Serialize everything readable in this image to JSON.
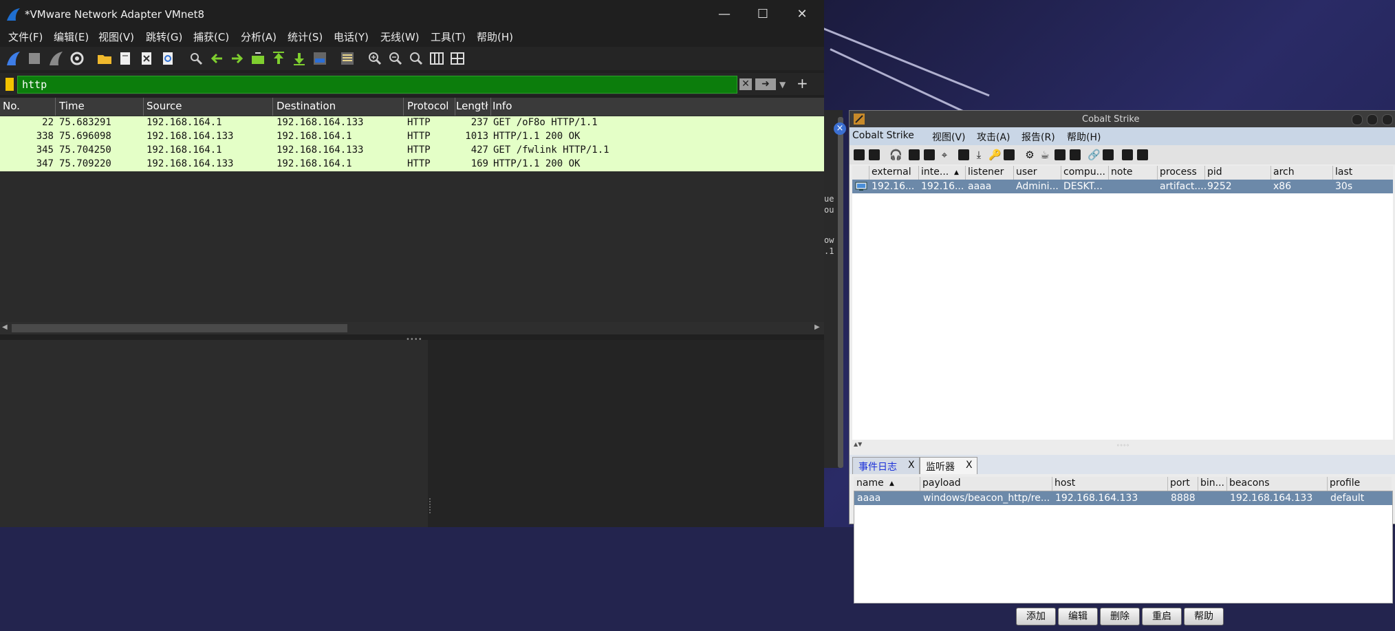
{
  "wireshark": {
    "title": "*VMware Network Adapter VMnet8",
    "menu": [
      "文件(F)",
      "编辑(E)",
      "视图(V)",
      "跳转(G)",
      "捕获(C)",
      "分析(A)",
      "统计(S)",
      "电话(Y)",
      "无线(W)",
      "工具(T)",
      "帮助(H)"
    ],
    "filter": "http",
    "columns": [
      "No.",
      "Time",
      "Source",
      "Destination",
      "Protocol",
      "Lengtł",
      "Info"
    ],
    "packets": [
      {
        "no": "22",
        "time": "75.683291",
        "src": "192.168.164.1",
        "dst": "192.168.164.133",
        "proto": "HTTP",
        "len": "237",
        "info": "GET /oF8o HTTP/1.1"
      },
      {
        "no": "338",
        "time": "75.696098",
        "src": "192.168.164.133",
        "dst": "192.168.164.1",
        "proto": "HTTP",
        "len": "1013",
        "info": "HTTP/1.1 200 OK"
      },
      {
        "no": "345",
        "time": "75.704250",
        "src": "192.168.164.1",
        "dst": "192.168.164.133",
        "proto": "HTTP",
        "len": "427",
        "info": "GET /fwlink HTTP/1.1"
      },
      {
        "no": "347",
        "time": "75.709220",
        "src": "192.168.164.133",
        "dst": "192.168.164.1",
        "proto": "HTTP",
        "len": "169",
        "info": "HTTP/1.1 200 OK"
      }
    ]
  },
  "terminal": {
    "fragments": [
      "ue",
      "ou",
      "ow",
      ".1"
    ]
  },
  "cobalt": {
    "title": "Cobalt Strike",
    "menu": [
      "Cobalt Strike",
      "视图(V)",
      "攻击(A)",
      "报告(R)",
      "帮助(H)"
    ],
    "session_columns": [
      "external",
      "inte...",
      "listener",
      "user",
      "compu...",
      "note",
      "process",
      "pid",
      "arch",
      "last"
    ],
    "session": {
      "external": "192.16...",
      "internal": "192.16...",
      "listener": "aaaa",
      "user": "Admini...",
      "computer": "DESKT...",
      "note": "",
      "process": "artifact....",
      "pid": "9252",
      "arch": "x86",
      "last": "30s"
    },
    "tabs": [
      {
        "label": "事件日志",
        "close": "X"
      },
      {
        "label": "监听器",
        "close": "X"
      }
    ],
    "listener_columns": [
      "name",
      "payload",
      "host",
      "port",
      "bin...",
      "beacons",
      "profile"
    ],
    "listener": {
      "name": "aaaa",
      "payload": "windows/beacon_http/re...",
      "host": "192.168.164.133",
      "port": "8888",
      "bind": "",
      "beacons": "192.168.164.133",
      "profile": "default"
    },
    "buttons": [
      "添加",
      "编辑",
      "删除",
      "重启",
      "帮助"
    ]
  }
}
